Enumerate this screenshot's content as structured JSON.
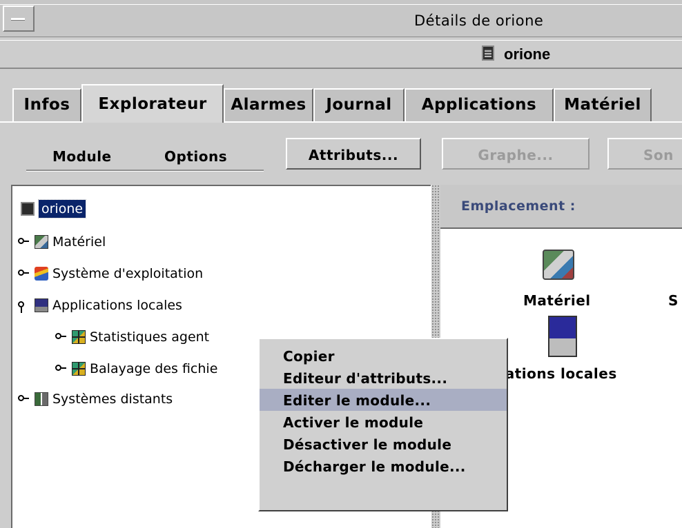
{
  "window": {
    "title": "Détails de orione"
  },
  "header": {
    "host_name": "orione"
  },
  "tabs": [
    {
      "label": "Infos"
    },
    {
      "label": "Explorateur",
      "active": true
    },
    {
      "label": "Alarmes"
    },
    {
      "label": "Journal"
    },
    {
      "label": "Applications"
    },
    {
      "label": "Matériel"
    }
  ],
  "toolbar": {
    "menu_module": "Module",
    "menu_options": "Options",
    "attributes_button": "Attributs...",
    "graph_button": "Graphe...",
    "probe_button": "Son"
  },
  "tree": {
    "root": {
      "label": "orione",
      "icon": "host-icon",
      "selected": true
    },
    "items": [
      {
        "label": "Matériel",
        "icon": "hardware-icon",
        "expanded": false
      },
      {
        "label": "Système d'exploitation",
        "icon": "operating-system-icon",
        "expanded": false
      },
      {
        "label": "Applications locales",
        "icon": "local-applications-icon",
        "expanded": true
      },
      {
        "label": "Statistiques agent",
        "icon": "module-icon",
        "expanded": false
      },
      {
        "label": "Balayage des fichie",
        "icon": "module-icon",
        "expanded": false
      },
      {
        "label": "Systèmes distants",
        "icon": "remote-systems-icon",
        "expanded": false
      }
    ]
  },
  "right_panel": {
    "location_label": "Emplacement :",
    "icons": [
      {
        "caption": "Matériel",
        "icon": "hardware-large-icon"
      },
      {
        "caption": "S",
        "icon": ""
      },
      {
        "caption": "ications locales",
        "icon": "local-applications-large-icon"
      }
    ]
  },
  "context_menu": {
    "items": [
      {
        "label": "Copier"
      },
      {
        "label": "Editeur d'attributs..."
      },
      {
        "label": "Editer le module...",
        "highlighted": true
      },
      {
        "label": "Activer le module"
      },
      {
        "label": "Désactiver le module"
      },
      {
        "label": "Décharger le module..."
      }
    ]
  },
  "colors": {
    "selection": "#0a246a",
    "menu_highlight": "#a9aec3",
    "location_text": "#3a4a7a",
    "window_bg": "#cdcdcd"
  }
}
